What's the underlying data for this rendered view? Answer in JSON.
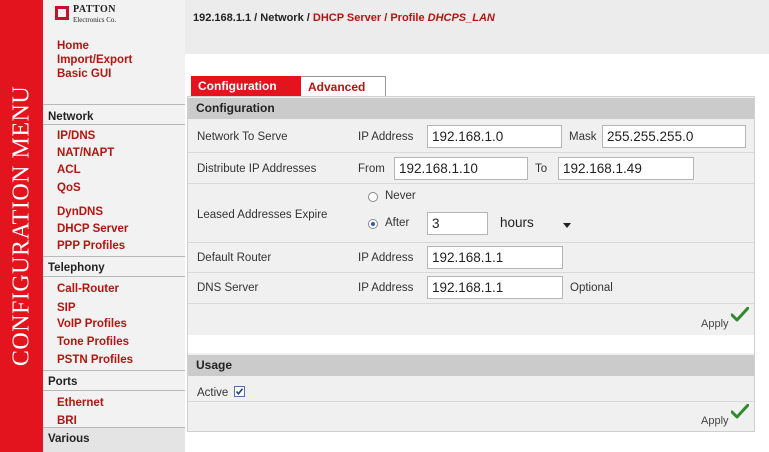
{
  "sidebar": {
    "title": "CONFIGURATION MENU"
  },
  "logo": {
    "line1": "PATTON",
    "line2": "Electronics Co."
  },
  "menu": {
    "top_items": [
      "Home",
      "Import/Export",
      "Basic GUI"
    ],
    "network": {
      "heading": "Network",
      "items": [
        "IP/DNS",
        "NAT/NAPT",
        "ACL",
        "QoS",
        "DynDNS",
        "DHCP Server",
        "PPP Profiles"
      ]
    },
    "telephony": {
      "heading": "Telephony",
      "items": [
        "Call-Router",
        "SIP",
        "VoIP Profiles",
        "Tone Profiles",
        "PSTN Profiles"
      ]
    },
    "ports": {
      "heading": "Ports",
      "items": [
        "Ethernet",
        "BRI"
      ]
    },
    "various": {
      "heading": "Various"
    }
  },
  "breadcrumb": {
    "ip": "192.168.1.1",
    "sep": " / ",
    "network": "Network",
    "dhcp": "DHCP Server",
    "profile_prefix": "Profile ",
    "profile_name": "DHCPS_LAN"
  },
  "tabs": {
    "configuration": "Configuration",
    "advanced": "Advanced"
  },
  "config": {
    "heading": "Configuration",
    "network_to_serve": {
      "label": "Network To Serve",
      "ip_label": "IP Address",
      "ip_value": "192.168.1.0",
      "mask_label": "Mask",
      "mask_value": "255.255.255.0"
    },
    "distribute": {
      "label": "Distribute IP Addresses",
      "from_label": "From",
      "from_value": "192.168.1.10",
      "to_label": "To",
      "to_value": "192.168.1.49"
    },
    "lease": {
      "label": "Leased Addresses Expire",
      "never_label": "Never",
      "after_label": "After",
      "after_value": "3",
      "unit_value": "hours",
      "selected": "After"
    },
    "default_router": {
      "label": "Default Router",
      "ip_label": "IP Address",
      "ip_value": "192.168.1.1"
    },
    "dns_server": {
      "label": "DNS Server",
      "ip_label": "IP Address",
      "ip_value": "192.168.1.1",
      "note": "Optional"
    },
    "apply_label": "Apply"
  },
  "usage": {
    "heading": "Usage",
    "active_label": "Active",
    "active_checked": true,
    "apply_label": "Apply"
  },
  "colors": {
    "accent": "#e3141d",
    "link": "#b5150f",
    "check": "#2e8b2e"
  }
}
